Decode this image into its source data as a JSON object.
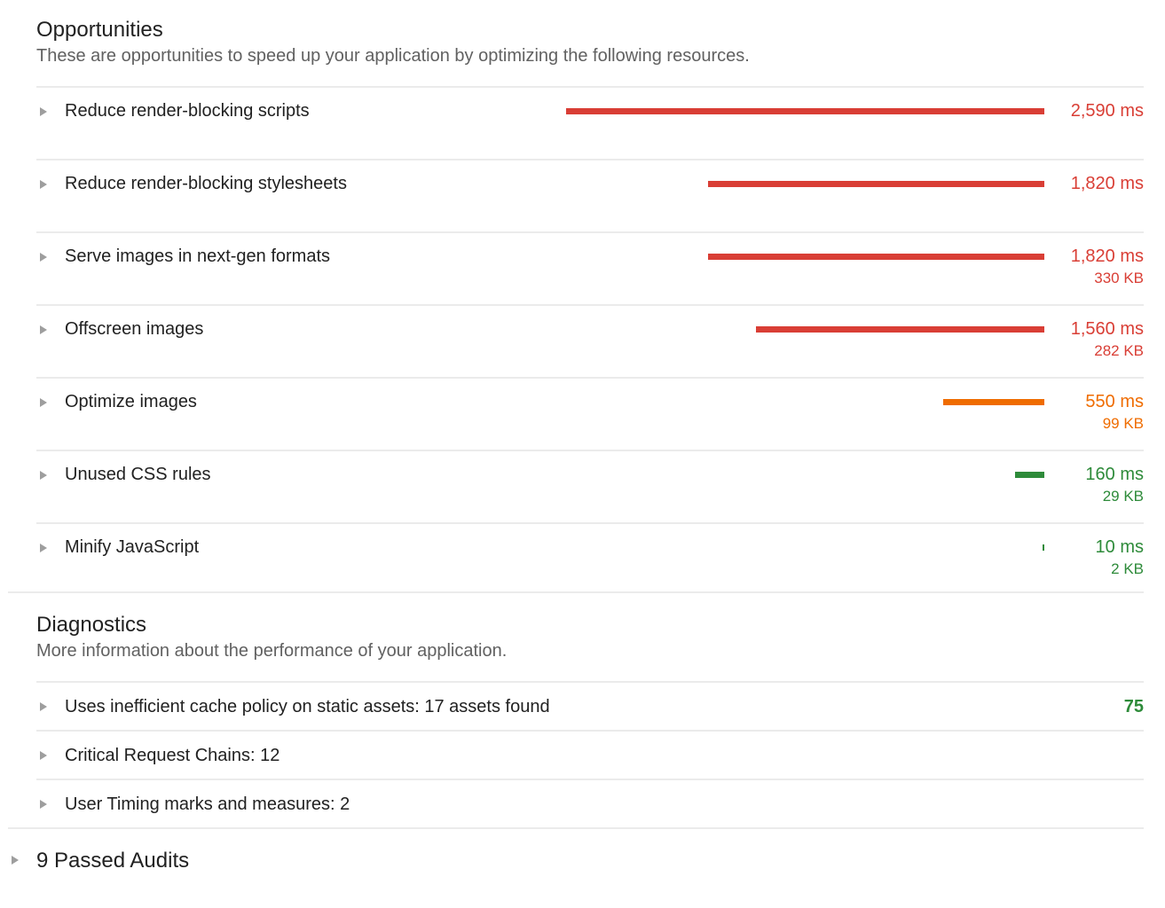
{
  "colors": {
    "fail": "#d93e35",
    "average": "#ef6c00",
    "pass": "#2e8b3a",
    "divider": "#ebebeb",
    "arrow": "#9e9e9e"
  },
  "opportunities": {
    "title": "Opportunities",
    "description": "These are opportunities to speed up your application by optimizing the following resources.",
    "max_ms": 2590,
    "items": [
      {
        "label": "Reduce render-blocking scripts",
        "ms": 2590,
        "ms_text": "2,590 ms",
        "kb_text": "",
        "status": "fail",
        "icon": "triangle-right-icon"
      },
      {
        "label": "Reduce render-blocking stylesheets",
        "ms": 1820,
        "ms_text": "1,820 ms",
        "kb_text": "",
        "status": "fail",
        "icon": "triangle-right-icon"
      },
      {
        "label": "Serve images in next-gen formats",
        "ms": 1820,
        "ms_text": "1,820 ms",
        "kb_text": "330 KB",
        "status": "fail",
        "icon": "triangle-right-icon"
      },
      {
        "label": "Offscreen images",
        "ms": 1560,
        "ms_text": "1,560 ms",
        "kb_text": "282 KB",
        "status": "fail",
        "icon": "triangle-right-icon"
      },
      {
        "label": "Optimize images",
        "ms": 550,
        "ms_text": "550 ms",
        "kb_text": "99 KB",
        "status": "average",
        "icon": "triangle-right-icon"
      },
      {
        "label": "Unused CSS rules",
        "ms": 160,
        "ms_text": "160 ms",
        "kb_text": "29 KB",
        "status": "pass",
        "icon": "triangle-right-icon"
      },
      {
        "label": "Minify JavaScript",
        "ms": 10,
        "ms_text": "10 ms",
        "kb_text": "2 KB",
        "status": "pass",
        "icon": "triangle-right-icon"
      }
    ]
  },
  "diagnostics": {
    "title": "Diagnostics",
    "description": "More information about the performance of your application.",
    "items": [
      {
        "label": "Uses inefficient cache policy on static assets: 17 assets found",
        "score": "75",
        "status": "pass",
        "icon": "triangle-right-icon"
      },
      {
        "label": "Critical Request Chains: 12",
        "score": "",
        "icon": "triangle-right-icon"
      },
      {
        "label": "User Timing marks and measures: 2",
        "score": "",
        "icon": "triangle-right-icon"
      }
    ]
  },
  "passed_audits": {
    "label": "9 Passed Audits",
    "icon": "triangle-right-icon"
  }
}
